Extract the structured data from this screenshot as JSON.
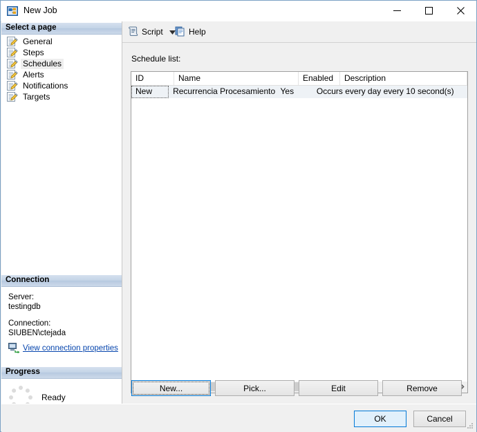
{
  "window": {
    "title": "New Job",
    "icon": "job-icon",
    "minimize_label": "Minimize",
    "maximize_label": "Maximize",
    "close_label": "Close"
  },
  "sidebar": {
    "select_a_page_header": "Select a page",
    "items": [
      {
        "label": "General",
        "icon": "page-icon",
        "selected": false
      },
      {
        "label": "Steps",
        "icon": "page-icon",
        "selected": false
      },
      {
        "label": "Schedules",
        "icon": "page-icon",
        "selected": true
      },
      {
        "label": "Alerts",
        "icon": "page-icon",
        "selected": false
      },
      {
        "label": "Notifications",
        "icon": "page-icon",
        "selected": false
      },
      {
        "label": "Targets",
        "icon": "page-icon",
        "selected": false
      }
    ],
    "connection": {
      "header": "Connection",
      "server_label": "Server:",
      "server_value": "testingdb",
      "connection_label": "Connection:",
      "connection_value": "SIUBEN\\ctejada",
      "link_text": "View connection properties",
      "link_icon": "connection-properties-icon",
      "link_color": "#0645ad"
    },
    "progress": {
      "header": "Progress",
      "status": "Ready",
      "spinner_icon": "progress-spinner-icon"
    }
  },
  "toolbar": {
    "script_label": "Script",
    "script_icon": "script-icon",
    "script_dropdown_icon": "chevron-down-icon",
    "help_label": "Help",
    "help_icon": "help-icon"
  },
  "main": {
    "list_caption": "Schedule list:",
    "columns": [
      "ID",
      "Name",
      "Enabled",
      "Description"
    ],
    "rows": [
      {
        "id": "New",
        "name": "Recurrencia Procesamiento Hog...",
        "enabled": "Yes",
        "description": "Occurs every day every 10 second(s)",
        "selected": true
      }
    ],
    "scrollbar": {
      "left_arrow_icon": "chevron-left-icon",
      "right_arrow_icon": "chevron-right-icon"
    },
    "buttons": {
      "new": "New...",
      "pick": "Pick...",
      "edit": "Edit",
      "remove": "Remove"
    }
  },
  "footer": {
    "ok": "OK",
    "cancel": "Cancel",
    "resize_grip_icon": "resize-grip-icon"
  },
  "colors": {
    "accent": "#0078d7",
    "section_header_start": "#d5e1ef",
    "section_header_end": "#b6c9e0",
    "link": "#0645ad",
    "selection_row": "#eef2f6"
  }
}
